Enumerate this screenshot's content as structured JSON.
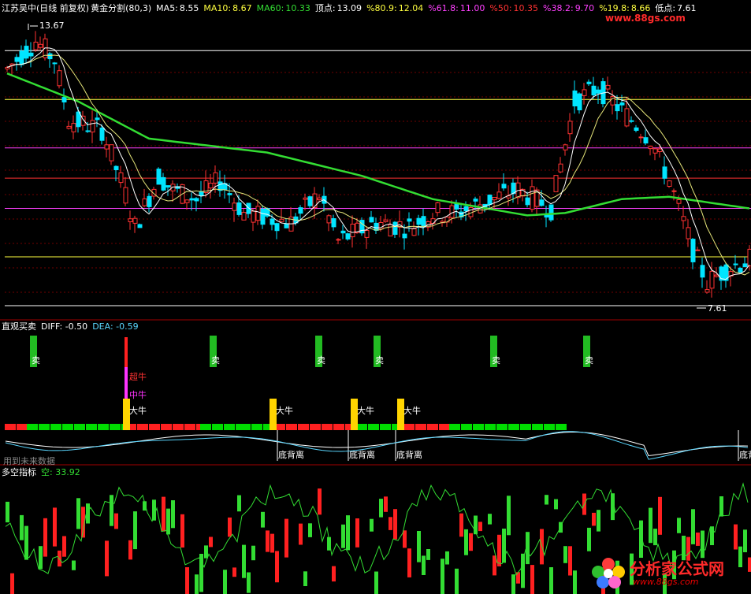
{
  "main_panel": {
    "stock": "江苏吴中(日线 前复权)",
    "indicator": "黄金分割(80,3)",
    "ma5_label": "MA5:",
    "ma5": "8.55",
    "ma10_label": "MA10:",
    "ma10": "8.67",
    "ma60_label": "MA60:",
    "ma60": "10.33",
    "top_label": "顶点:",
    "top": "13.09",
    "p809_label": "%80.9:",
    "p809": "12.04",
    "p618_label": "%61.8:",
    "p618": "11.00",
    "p50_label": "%50:",
    "p50": "10.35",
    "p382_label": "%38.2:",
    "p382": "9.70",
    "p198_label": "%19.8:",
    "p198": "8.66",
    "low_label": "低点:",
    "low": "7.61",
    "high_mark": "13.67",
    "low_mark": "7.61"
  },
  "macd_panel": {
    "title": "直观买卖",
    "diff": "DIFF: -0.50",
    "dea": "DEA: -0.59",
    "sell_label": "卖",
    "bull_big": "大牛",
    "bull_mid": "中牛",
    "bull_super": "超牛",
    "divergence": "底背离",
    "future_note": "用到未来数据"
  },
  "bottom_panel": {
    "title": "多空指标",
    "value": "空: 33.92"
  },
  "watermark": {
    "title": "分析家公式网",
    "url": "www.88gs.com",
    "header_url": "www.88gs.com"
  },
  "colors": {
    "up": "#ff3232",
    "down": "#00e5ff",
    "ma5": "#ffffff",
    "ma10": "#ffff40",
    "ma60": "#33dd33",
    "magenta": "#ff40ff",
    "yellow": "#ffff00",
    "green_bar": "#00dd00"
  }
}
